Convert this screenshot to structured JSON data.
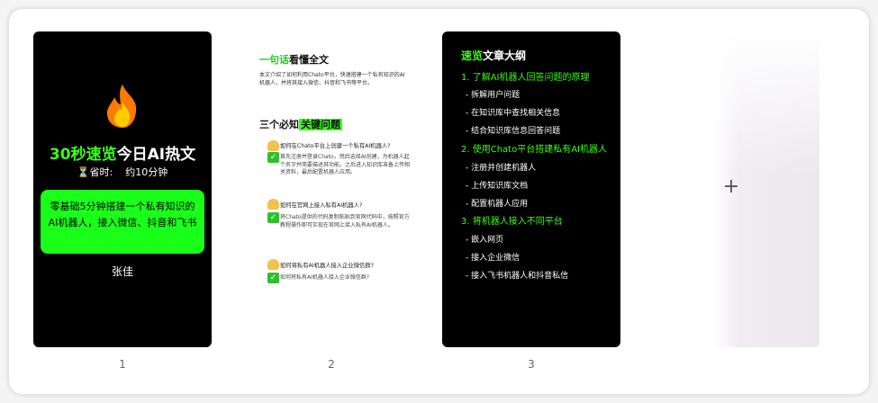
{
  "card1": {
    "title_green": "30秒速览",
    "title_white": "今日AI热文",
    "time_label": "⏳省时:",
    "time_value": "约10分钟",
    "summary": "零基础5分钟搭建一个私有知识的AI机器人，接入微信、抖音和飞书",
    "author": "张佳"
  },
  "card2": {
    "heading1_green": "一句话",
    "heading1_rest": "看懂全文",
    "summary_text": "本文介绍了如何利用Chato平台，快速搭建一个私有知识的AI机器人，并将其接入微信、抖音和飞书等平台。",
    "heading2_pre": "三个必知",
    "heading2_hl": "关键问题",
    "qa": [
      {
        "q": "如何在Chato平台上创建一个私有AI机器人?",
        "a": "首先注册并登录Chato，然后选择AI创建，为机器人起个名字并简要描述其功能。之后进入知识库准备上传相关资料，最后配置机器人应用。"
      },
      {
        "q": "如何在官网上接入私有AI机器人?",
        "a": "将Chato提供的代码复制粘贴到官网代码中，按照官方教程操作即可实现在官网上接入私有AI机器人。"
      },
      {
        "q": "如何将私有AI机器人接入企业微信群?",
        "a": "如何将私有AI机器人接入企业微信群?"
      }
    ]
  },
  "card3": {
    "title_green": "速览",
    "title_white": "文章大纲",
    "sections": [
      {
        "title": "1. 了解AI机器人回答问题的原理",
        "items": [
          "- 拆解用户问题",
          "- 在知识库中查找相关信息",
          "- 结合知识库信息回答问题"
        ]
      },
      {
        "title": "2. 使用Chato平台搭建私有AI机器人",
        "items": [
          "- 注册并创建机器人",
          "- 上传知识库文档",
          "- 配置机器人应用"
        ]
      },
      {
        "title": "3. 将机器人接入不同平台",
        "items": [
          "- 嵌入网页",
          "- 接入企业微信",
          "- 接入飞书机器人和抖音私信"
        ]
      }
    ]
  },
  "add_card": {
    "icon": "plus-icon",
    "symbol": "+"
  },
  "page_numbers": [
    "1",
    "2",
    "3"
  ],
  "colors": {
    "accent_green": "#39ff14",
    "box_green": "#1aff1a",
    "card_dark": "#000000"
  }
}
